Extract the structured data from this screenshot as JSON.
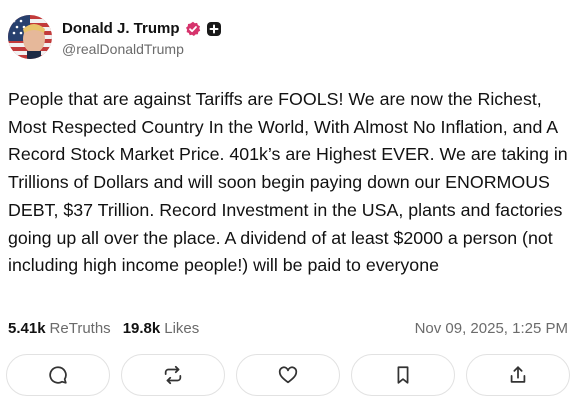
{
  "author": {
    "display_name": "Donald J. Trump",
    "handle": "@realDonaldTrump",
    "verified_badge_icon": "verified-check-icon",
    "extra_badge_icon": "plus-square-icon",
    "verified_color": "#d6336c"
  },
  "post": {
    "text": "People that are against Tariffs are FOOLS! We are now the Richest, Most Respected Country In the World, With Almost No Inflation, and A Record Stock Market Price. 401k’s are Highest EVER. We are taking in Trillions of Dollars and will soon begin paying down our ENORMOUS DEBT, $37 Trillion. Record Investment in the USA, plants and factories going up all over the place. A dividend of at least $2000 a person (not including high income people!) will be paid to everyone"
  },
  "stats": {
    "retruths_count": "5.41k",
    "retruths_label": "ReTruths",
    "likes_count": "19.8k",
    "likes_label": "Likes",
    "timestamp": "Nov 09, 2025, 1:25 PM"
  },
  "actions": [
    {
      "name": "reply",
      "icon": "comment-bubble-icon"
    },
    {
      "name": "retruth",
      "icon": "retruth-arrows-icon"
    },
    {
      "name": "like",
      "icon": "heart-icon"
    },
    {
      "name": "bookmark",
      "icon": "bookmark-icon"
    },
    {
      "name": "share",
      "icon": "share-upload-icon"
    }
  ]
}
